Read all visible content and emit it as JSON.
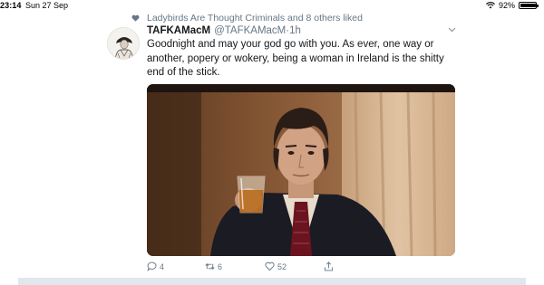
{
  "status_bar": {
    "time": "23:14",
    "date": "Sun 27 Sep",
    "battery": "92%",
    "battery_level": 0.92
  },
  "social_context": {
    "text": "Ladybirds Are Thought Criminals and 8 others liked",
    "icon": "heart-icon"
  },
  "tweet": {
    "display_name": "TAFKAMacM",
    "handle": "@TAFKAMacM",
    "time": "1h",
    "separator": "·",
    "text": "Goodnight and may your god go with you. As ever, one way or another, popery or wokery, being a woman in Ireland is the shitty end of the stick.",
    "actions": {
      "replies": "4",
      "retweets": "6",
      "likes": "52"
    }
  },
  "colors": {
    "text": "#14171a",
    "muted": "#657786",
    "divider": "#e1e8ed"
  }
}
